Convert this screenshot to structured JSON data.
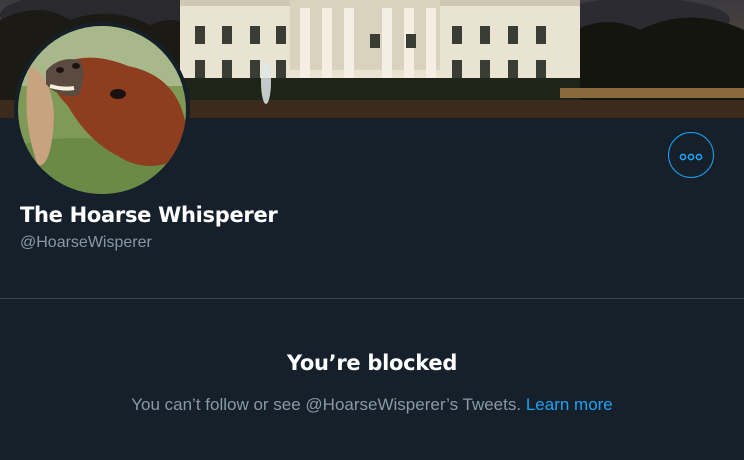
{
  "profile": {
    "display_name": "The Hoarse Whisperer",
    "handle": "@HoarseWisperer"
  },
  "blocked": {
    "title": "You’re blocked",
    "message": "You can’t follow or see @HoarseWisperer’s Tweets.",
    "learn_more": "Learn more"
  },
  "icons": {
    "more": "more-options-icon"
  },
  "colors": {
    "background": "#15202b",
    "accent": "#1da1f2",
    "secondary_text": "#8899a6",
    "divider": "#38444d"
  }
}
